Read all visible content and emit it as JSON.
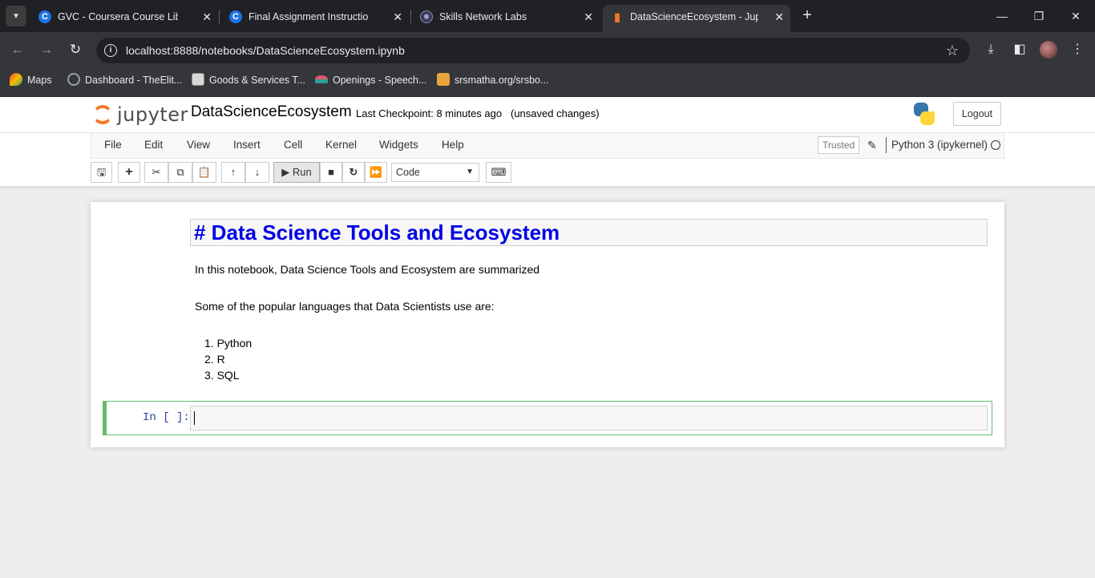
{
  "browser": {
    "tabs": [
      {
        "title": "GVC - Coursera Course Library |",
        "icon": "coursera-icon",
        "active": false
      },
      {
        "title": "Final Assignment Instructions: C",
        "icon": "coursera-icon",
        "active": false
      },
      {
        "title": "Skills Network Labs",
        "icon": "skills-network-icon",
        "active": false
      },
      {
        "title": "DataScienceEcosystem - Jupyter",
        "icon": "jupyter-notebook-icon",
        "active": true
      }
    ],
    "url": "localhost:8888/notebooks/DataScienceEcosystem.ipynb",
    "bookmarks": [
      {
        "label": "Maps"
      },
      {
        "label": "Dashboard - TheElit..."
      },
      {
        "label": "Goods & Services T..."
      },
      {
        "label": "Openings - Speech..."
      },
      {
        "label": "srsmatha.org/srsbo..."
      }
    ]
  },
  "jupyter": {
    "logo_text": "jupyter",
    "notebook_name": "DataScienceEcosystem",
    "checkpoint": "Last Checkpoint: 8 minutes ago",
    "unsaved": "(unsaved changes)",
    "logout": "Logout",
    "menu": [
      "File",
      "Edit",
      "View",
      "Insert",
      "Cell",
      "Kernel",
      "Widgets",
      "Help"
    ],
    "trusted": "Trusted",
    "kernel": "Python 3 (ipykernel)",
    "toolbar": {
      "run_label": "Run",
      "cell_type": "Code"
    }
  },
  "notebook": {
    "heading": "# Data Science Tools and Ecosystem",
    "intro": "In this notebook, Data Science Tools and Ecosystem are summarized",
    "languages_intro": "Some of the popular languages that Data Scientists use are:",
    "languages": [
      "1. Python",
      "2. R",
      "3. SQL"
    ],
    "code_prompt": "In [ ]:"
  }
}
